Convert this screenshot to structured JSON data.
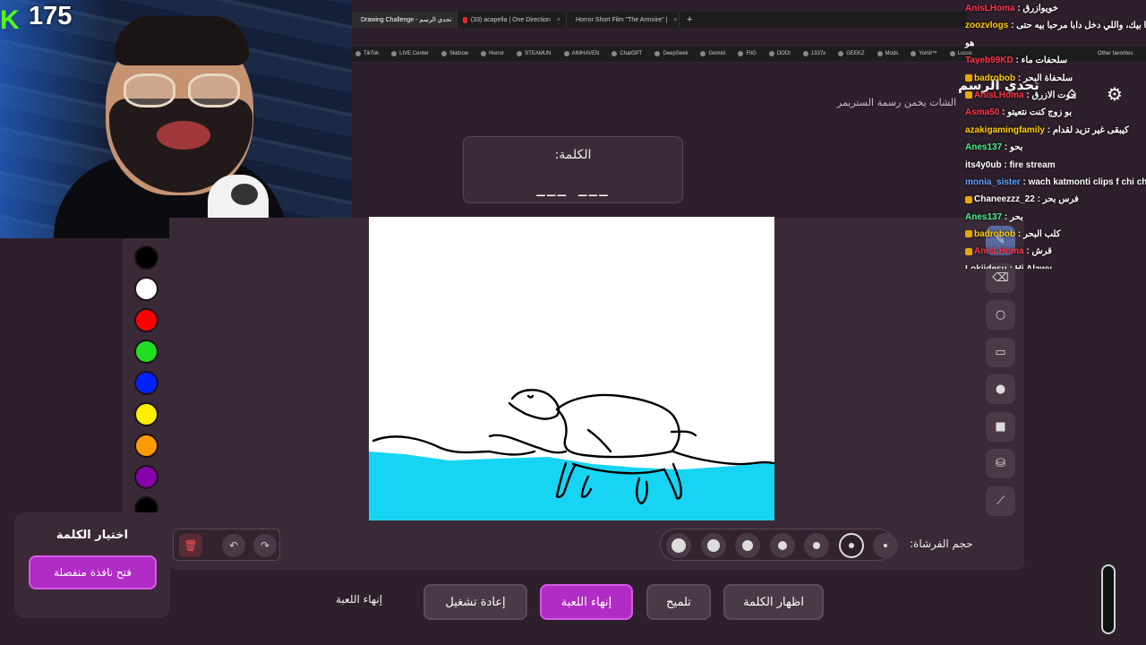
{
  "webcam": {
    "platform_icon": "kick-logo-icon",
    "viewer_count": "175",
    "platform_glyph": "K"
  },
  "browser": {
    "tabs": [
      {
        "label": "Drawing Challenge - تحدي الرسم",
        "active": true
      },
      {
        "label": "(33) acapella | One Direction",
        "active": false
      },
      {
        "label": "Horror Short Film \"The Armoire\" |",
        "active": false
      }
    ],
    "new_tab": "+",
    "bookmarks": [
      "TikTok",
      "LIVE Center",
      "Skidrow",
      "Horror",
      "STEAMUN",
      "AIMHAVEN",
      "ChatGPT",
      "DeepSeek",
      "Gemini",
      "FitG",
      "DODI",
      "1337x",
      "GEEKZ",
      "Mods",
      "Yomil™",
      "Lucus"
    ],
    "other_favorites": "Other favorites"
  },
  "header": {
    "title": "تحدي الرسم",
    "subtitle": "الشات يخمن رسمة الستريمر",
    "home_icon": "home-icon",
    "settings_icon": "gear-icon"
  },
  "word_card": {
    "label": "الكلمة:",
    "blanks": "___   ___"
  },
  "palette": {
    "colors": [
      "#000000",
      "#ffffff",
      "#ff0000",
      "#22dd22",
      "#0022ff",
      "#ffee00",
      "#ff9900",
      "#8800aa",
      "#000000"
    ]
  },
  "tools": [
    "pen-icon",
    "eraser-icon",
    "circle-icon",
    "rect-outline-icon",
    "circle-fill-icon",
    "rect-fill-icon",
    "fill-bucket-icon",
    "line-icon"
  ],
  "brush": {
    "label": "حجم الفرشاة:",
    "sizes": [
      7,
      6,
      5,
      4,
      3,
      2,
      1
    ],
    "selected_index": 5
  },
  "edit": {
    "trash_icon": "trash-icon",
    "undo_icon": "undo-icon",
    "redo_icon": "redo-icon",
    "undo": "↶",
    "redo": "↷",
    "trash": "🗑"
  },
  "actions": {
    "end_text": "إنهاء اللعبة",
    "restart": "إعادة تشغيل",
    "end_game": "إنهاء اللعبة",
    "hint": "تلميح",
    "reveal": "اظهار الكلمة"
  },
  "choose_word": {
    "title": "اختيار الكلمة",
    "open_window": "فتح نافذة منفصلة"
  },
  "chat": [
    {
      "user": "AnisLHoma",
      "msg": "خويوازرق",
      "color": "#ff3344",
      "badge": false
    },
    {
      "user": "zoozvlogs",
      "msg": "مرحبا بيك، واللي دخل دابا مرحبا بيه حتى",
      "color": "#ffcc00",
      "badge": false
    },
    {
      "user": "",
      "msg": "هو",
      "color": "#ffffff",
      "badge": false
    },
    {
      "user": "Tayeb99KD",
      "msg": "سلحفات ماء",
      "color": "#ff3344",
      "badge": false
    },
    {
      "user": "badrobob",
      "msg": "سلحفاة البحر",
      "color": "#ffcc00",
      "badge": true
    },
    {
      "user": "AnisLHoma",
      "msg": "حوت الازرق",
      "color": "#ff3344",
      "badge": true
    },
    {
      "user": "Asma50",
      "msg": "بو زوج كنت نتعيتو",
      "color": "#ff3344",
      "badge": false
    },
    {
      "user": "azakigamingfamily",
      "msg": "كيبقى غير تزيد لقدام",
      "color": "#ffcc00",
      "badge": false
    },
    {
      "user": "Anes137",
      "msg": "بحو",
      "color": "#44ee88",
      "badge": false
    },
    {
      "user": "its4y0ub",
      "msg": "fire stream",
      "color": "#ffffff",
      "badge": false
    },
    {
      "user": "monia_sister",
      "msg": "wach katmonti clips f chi ch",
      "color": "#5aa0ff",
      "badge": false
    },
    {
      "user": "Chaneezzz_22",
      "msg": "فرس بحر",
      "color": "#ffffff",
      "badge": true
    },
    {
      "user": "Anes137",
      "msg": "بحر",
      "color": "#44ee88",
      "badge": false
    },
    {
      "user": "badrobob",
      "msg": "كلب البحر",
      "color": "#ffcc00",
      "badge": true
    },
    {
      "user": "AnisLHoma",
      "msg": "قرش",
      "color": "#ff3344",
      "badge": true
    },
    {
      "user": "Lokiidesu",
      "msg": "Hi Alawy",
      "color": "#ffffff",
      "badge": false
    }
  ]
}
